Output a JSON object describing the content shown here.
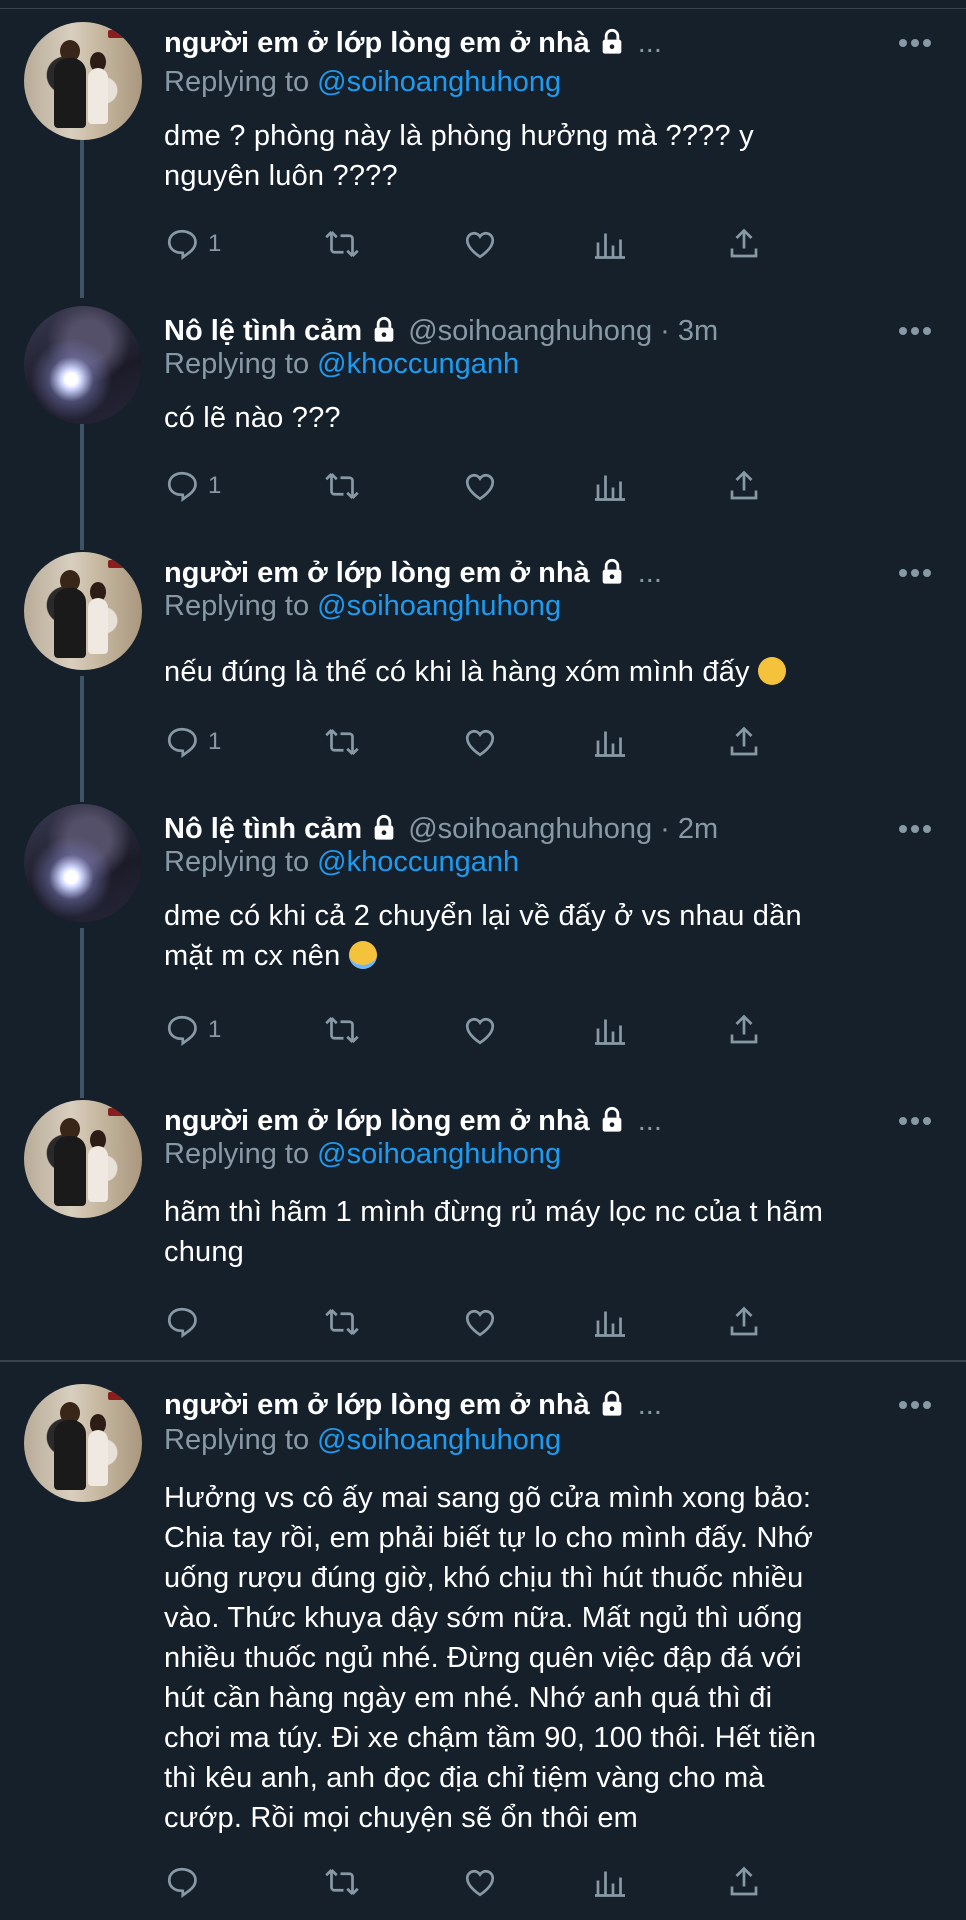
{
  "tweets": [
    {
      "name": "người em ở lớp lòng em ở nhà",
      "handle": "",
      "time": "",
      "truncated": "...",
      "replying_prefix": "Replying to",
      "replying_to": "@soihoanghuhong",
      "text_lines": [
        "dme ? phòng này là phòng hưởng mà ???? y",
        "nguyên luôn ????"
      ],
      "reply_count": "1"
    },
    {
      "name": "Nô lệ tình cảm",
      "handle": "@soihoanghuhong",
      "time": "3m",
      "truncated": "",
      "replying_prefix": "Replying to",
      "replying_to": "@khoccunganh",
      "text_lines": [
        "có lẽ nào ???"
      ],
      "reply_count": "1"
    },
    {
      "name": "người em ở lớp lòng em ở nhà",
      "handle": "",
      "time": "",
      "truncated": "...",
      "replying_prefix": "Replying to",
      "replying_to": "@soihoanghuhong",
      "text_lines": [
        "nếu đúng là thế có khi là hàng xóm mình đấy"
      ],
      "emoji": "grin",
      "reply_count": "1"
    },
    {
      "name": "Nô lệ tình cảm",
      "handle": "@soihoanghuhong",
      "time": "2m",
      "truncated": "",
      "replying_prefix": "Replying to",
      "replying_to": "@khoccunganh",
      "text_lines": [
        "dme có khi cả 2 chuyển lại về đấy ở vs nhau dần",
        "mặt m cx nên"
      ],
      "emoji": "halo",
      "reply_count": "1"
    },
    {
      "name": "người em ở lớp lòng em ở nhà",
      "handle": "",
      "time": "",
      "truncated": "...",
      "replying_prefix": "Replying to",
      "replying_to": "@soihoanghuhong",
      "text_lines": [
        "hãm thì hãm 1 mình đừng rủ máy lọc nc của t hãm",
        "chung"
      ],
      "reply_count": ""
    },
    {
      "name": "người em ở lớp lòng em ở nhà",
      "handle": "",
      "time": "",
      "truncated": "...",
      "replying_prefix": "Replying to",
      "replying_to": "@soihoanghuhong",
      "text_lines": [
        "Hưởng vs cô ấy mai sang gõ cửa mình xong bảo:",
        "Chia tay rồi, em phải biết tự lo cho mình đấy. Nhớ",
        "uống rượu đúng giờ, khó chịu thì hút thuốc nhiều",
        "vào. Thức khuya dậy sớm nữa. Mất ngủ thì uống",
        "nhiều thuốc ngủ nhé. Đừng quên việc đập đá với",
        "hút cần hàng ngày em nhé. Nhớ anh quá thì đi",
        "chơi ma túy. Đi xe chậm tầm 90, 100 thôi. Hết tiền",
        "thì kêu anh, anh đọc địa chỉ tiệm vàng cho mà",
        "cướp. Rồi mọi chuyện sẽ ổn thôi em"
      ],
      "reply_count": ""
    }
  ],
  "colors": {
    "background": "#15202b",
    "secondary_text": "#8899a6",
    "mention": "#1d9bf0",
    "divider": "#38444d",
    "thread_line": "#3d5466"
  },
  "icons": [
    "reply-icon",
    "retweet-icon",
    "like-icon",
    "analytics-icon",
    "share-icon",
    "lock-icon",
    "more-icon"
  ]
}
